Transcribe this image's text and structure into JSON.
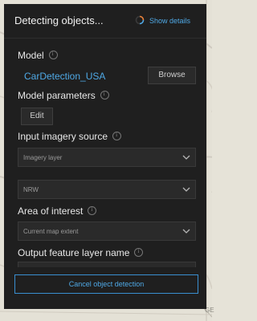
{
  "header": {
    "title": "Detecting objects...",
    "show_details_label": "Show details",
    "spinner_icon": "loading-spinner-icon",
    "accent_color": "#4fa9e6"
  },
  "model": {
    "label": "Model",
    "value": "CarDetection_USA",
    "browse_label": "Browse"
  },
  "model_parameters": {
    "label": "Model parameters",
    "edit_label": "Edit"
  },
  "input_imagery": {
    "label": "Input imagery source",
    "imagery_dropdown_value": "Imagery layer",
    "layer_dropdown_value": "NRW"
  },
  "area_of_interest": {
    "label": "Area of interest",
    "dropdown_value": "Current map extent"
  },
  "output": {
    "label": "Output feature layer name"
  },
  "footer": {
    "cancel_label": "Cancel object detection"
  },
  "map": {
    "label": "GE"
  }
}
